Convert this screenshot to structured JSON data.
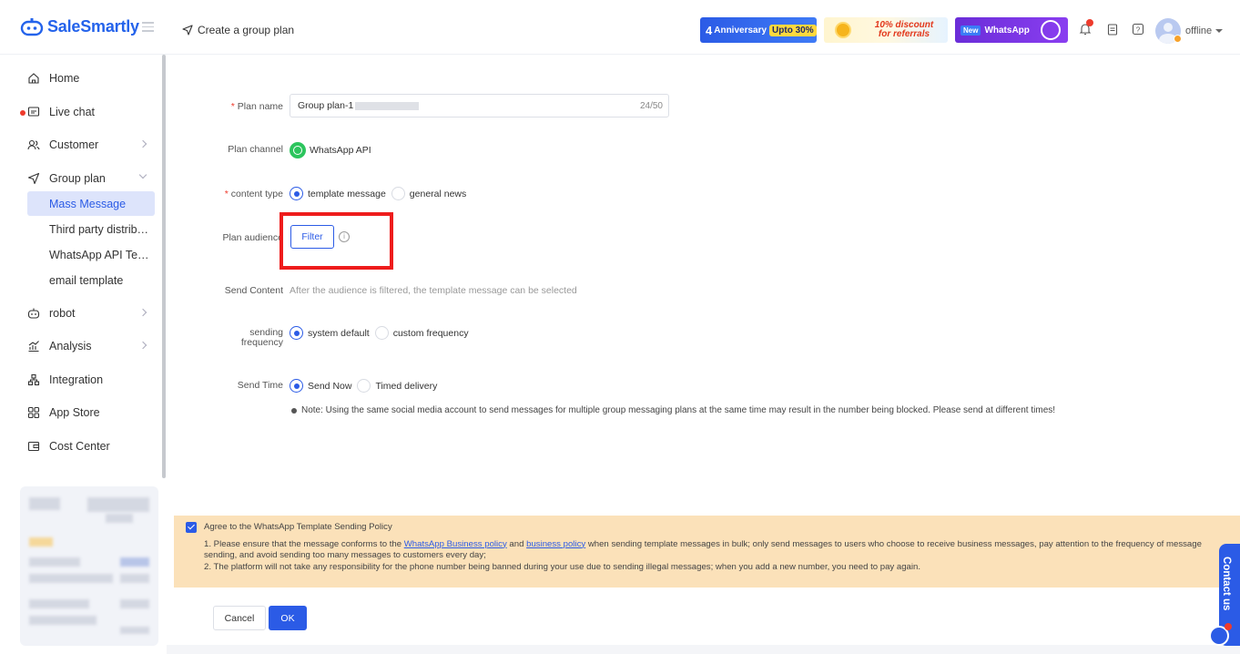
{
  "header": {
    "logo_text": "SaleSmartly",
    "page_title": "Create a group plan",
    "banners": {
      "anniversary_num": "4",
      "anniversary_text": "Anniversary",
      "anniversary_offer": "Upto 30%",
      "discount_line1": "10% discount",
      "discount_line2": "for referrals",
      "wa_new": "New",
      "wa_text": "WhatsApp"
    },
    "status": "offline"
  },
  "sidebar": {
    "items": [
      {
        "label": "Home",
        "icon": "home-icon"
      },
      {
        "label": "Live chat",
        "icon": "chat-icon"
      },
      {
        "label": "Customer",
        "icon": "customer-icon"
      },
      {
        "label": "Group plan",
        "icon": "send-icon"
      },
      {
        "label": "robot",
        "icon": "robot-icon"
      },
      {
        "label": "Analysis",
        "icon": "analysis-icon"
      },
      {
        "label": "Integration",
        "icon": "integration-icon"
      },
      {
        "label": "App Store",
        "icon": "app-store-icon"
      },
      {
        "label": "Cost Center",
        "icon": "wallet-icon"
      }
    ],
    "group_plan_sub": [
      "Mass Message",
      "Third party distrib…",
      "WhatsApp API Te…",
      "email template"
    ]
  },
  "form": {
    "plan_name_label": "Plan name",
    "plan_name_value": "Group plan-1",
    "plan_name_count": "24/50",
    "plan_channel_label": "Plan channel",
    "plan_channel_value": "WhatsApp API",
    "content_type_label": "content type",
    "content_type_options": [
      "template message",
      "general news"
    ],
    "plan_audience_label": "Plan audience",
    "filter_button": "Filter",
    "info_glyph": "i",
    "send_content_label": "Send Content",
    "send_content_hint": "After the audience is filtered, the template message can be selected",
    "sending_frequency_label_1": "sending",
    "sending_frequency_label_2": "frequency",
    "frequency_options": [
      "system default",
      "custom frequency"
    ],
    "send_time_label": "Send Time",
    "send_time_options": [
      "Send Now",
      "Timed delivery"
    ],
    "note": "Note: Using the same social media account to send messages for multiple group messaging plans at the same time may result in the number being blocked. Please send at different times!"
  },
  "policy": {
    "agree": "Agree to the WhatsApp Template Sending Policy",
    "line1_a": "1. Please ensure that the message conforms to the ",
    "link1": "WhatsApp Business policy",
    "line1_b": " and ",
    "link2": "business policy",
    "line1_c": " when sending template messages in bulk; only send messages to users who choose to receive business messages, pay attention to the frequency of message sending, and avoid sending too many messages to customers every day;",
    "line2": "2. The platform will not take any responsibility for the phone number being banned during your use due to sending illegal messages; when you add a new number, you need to pay again."
  },
  "actions": {
    "cancel": "Cancel",
    "ok": "OK"
  },
  "contact_us": "Contact us",
  "colors": {
    "accent": "#2b5be6",
    "highlight": "#ee1c1c",
    "policy_bg": "#fbe1b9"
  }
}
